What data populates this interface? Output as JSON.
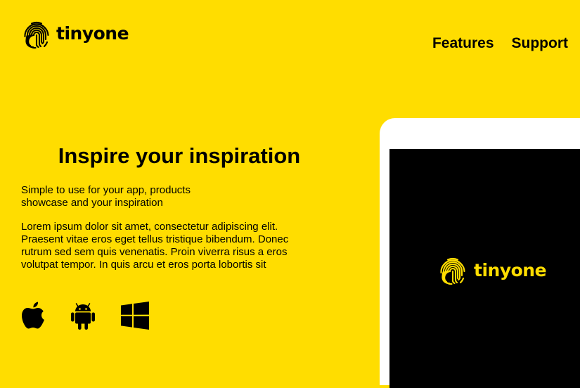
{
  "brand": {
    "name": "tinyone",
    "accent_color": "#FFDD00",
    "logo_icon": "fingerprint-icon"
  },
  "nav": {
    "items": [
      {
        "label": "Features"
      },
      {
        "label": "Support"
      }
    ]
  },
  "hero": {
    "title": "Inspire your inspiration",
    "subtitle_line1": "Simple to use for your app, products",
    "subtitle_line2": "showcase and your inspiration",
    "body_line1": "Lorem ipsum dolor sit amet, consectetur adipiscing elit.",
    "body_line2": "Praesent vitae eros eget tellus tristique bibendum. Donec",
    "body_line3": "rutrum sed sem quis venenatis. Proin viverra risus a eros",
    "body_line4": "volutpat tempor. In quis arcu et eros porta lobortis sit"
  },
  "platforms": [
    {
      "icon": "apple-icon"
    },
    {
      "icon": "android-icon"
    },
    {
      "icon": "windows-icon"
    }
  ],
  "device": {
    "screen_brand": "tinyone"
  }
}
